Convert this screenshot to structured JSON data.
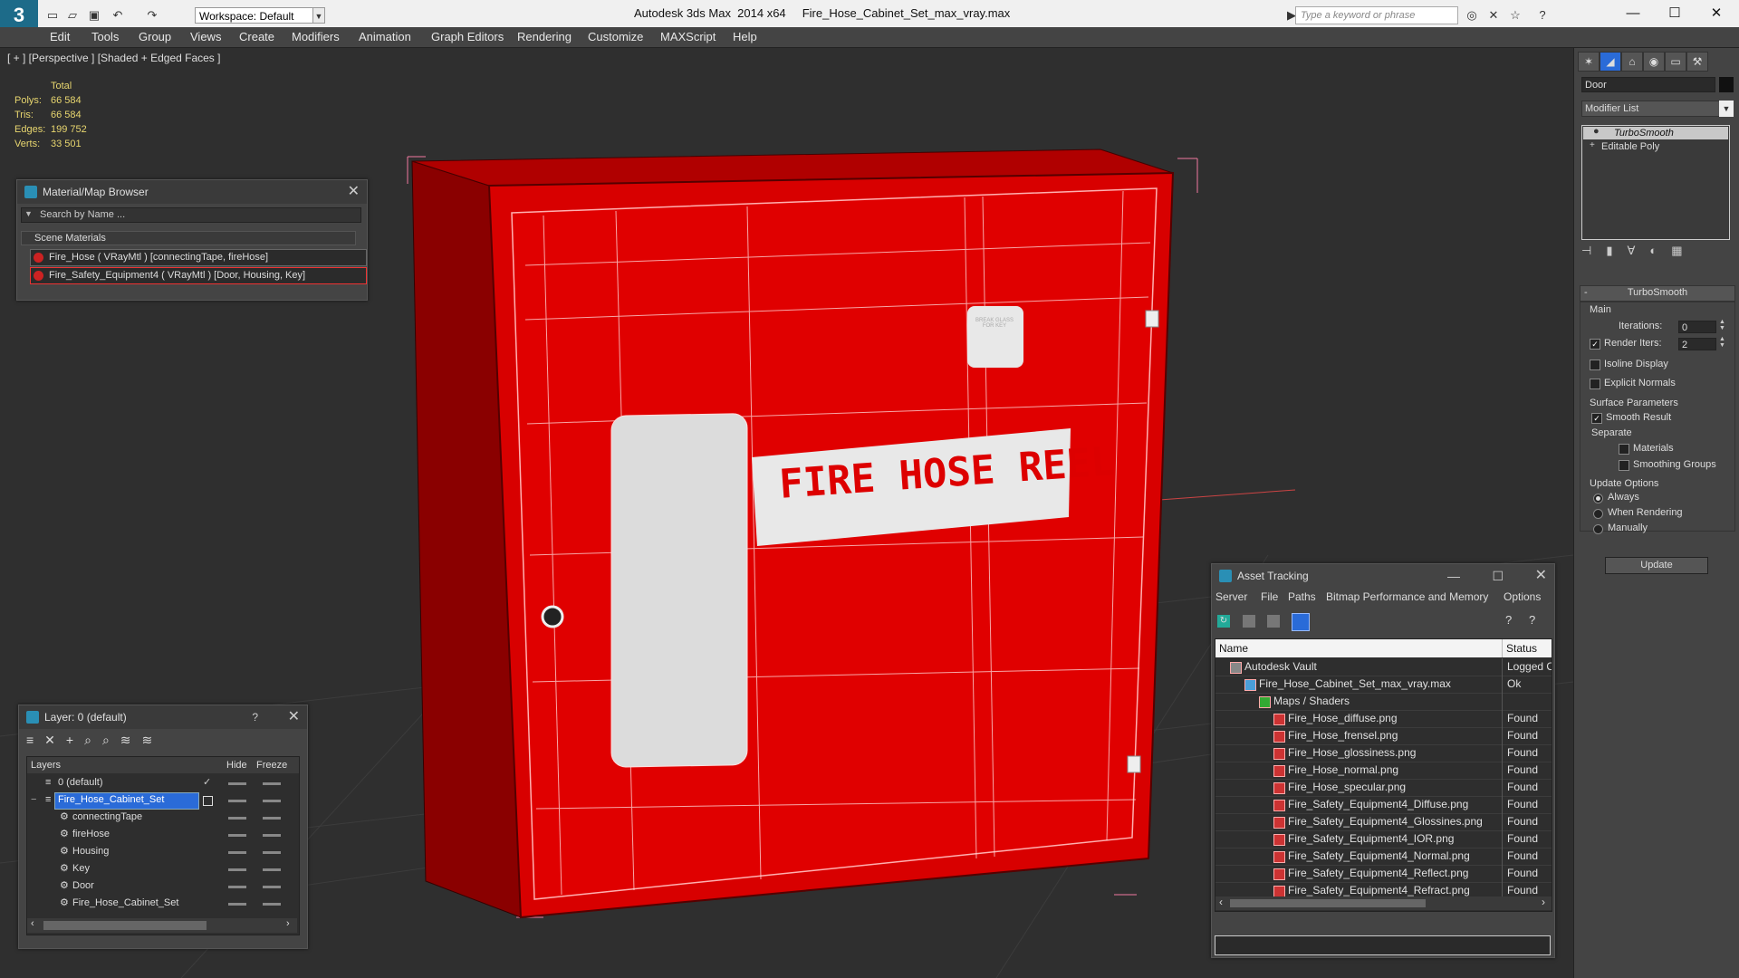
{
  "titlebar": {
    "workspace": "Workspace: Default",
    "title": "Autodesk 3ds Max  2014 x64     Fire_Hose_Cabinet_Set_max_vray.max",
    "search_placeholder": "Type a keyword or phrase"
  },
  "menu": [
    "Edit",
    "Tools",
    "Group",
    "Views",
    "Create",
    "Modifiers",
    "Animation",
    "Graph Editors",
    "Rendering",
    "Customize",
    "MAXScript",
    "Help"
  ],
  "viewport": {
    "label": "[ + ] [Perspective ] [Shaded + Edged Faces ]",
    "stats": {
      "header": "Total",
      "rows": [
        {
          "label": "Polys:",
          "value": "66 584"
        },
        {
          "label": "Tris:",
          "value": "66 584"
        },
        {
          "label": "Edges:",
          "value": "199 752"
        },
        {
          "label": "Verts:",
          "value": "33 501"
        }
      ]
    },
    "sign_text": "FIRE HOSE REEL",
    "small_sign_text": "BREAK GLASS FOR KEY"
  },
  "material_browser": {
    "title": "Material/Map Browser",
    "search_placeholder": "Search by Name ...",
    "section": "Scene Materials",
    "items": [
      "Fire_Hose  ( VRayMtl )  [connectingTape, fireHose]",
      "Fire_Safety_Equipment4  ( VRayMtl )  [Door, Housing, Key]"
    ]
  },
  "layer_panel": {
    "title": "Layer: 0 (default)",
    "help": "?",
    "columns": [
      "Layers",
      "Hide",
      "Freeze"
    ],
    "rows": [
      {
        "name": "0 (default)",
        "indent": 1
      },
      {
        "name": "Fire_Hose_Cabinet_Set",
        "indent": 1,
        "selected": true
      },
      {
        "name": "connectingTape",
        "indent": 2
      },
      {
        "name": "fireHose",
        "indent": 2
      },
      {
        "name": "Housing",
        "indent": 2
      },
      {
        "name": "Key",
        "indent": 2
      },
      {
        "name": "Door",
        "indent": 2
      },
      {
        "name": "Fire_Hose_Cabinet_Set",
        "indent": 2
      }
    ]
  },
  "asset_tracking": {
    "title": "Asset Tracking",
    "menu": [
      "Server",
      "File",
      "Paths",
      "Bitmap Performance and Memory",
      "Options"
    ],
    "columns": [
      "Name",
      "Status"
    ],
    "rows": [
      {
        "name": "Autodesk Vault",
        "status": "Logged O",
        "indent": 1
      },
      {
        "name": "Fire_Hose_Cabinet_Set_max_vray.max",
        "status": "Ok",
        "indent": 2
      },
      {
        "name": "Maps / Shaders",
        "status": "",
        "indent": 3
      },
      {
        "name": "Fire_Hose_diffuse.png",
        "status": "Found",
        "indent": 4
      },
      {
        "name": "Fire_Hose_frensel.png",
        "status": "Found",
        "indent": 4
      },
      {
        "name": "Fire_Hose_glossiness.png",
        "status": "Found",
        "indent": 4
      },
      {
        "name": "Fire_Hose_normal.png",
        "status": "Found",
        "indent": 4
      },
      {
        "name": "Fire_Hose_specular.png",
        "status": "Found",
        "indent": 4
      },
      {
        "name": "Fire_Safety_Equipment4_Diffuse.png",
        "status": "Found",
        "indent": 4
      },
      {
        "name": "Fire_Safety_Equipment4_Glossines.png",
        "status": "Found",
        "indent": 4
      },
      {
        "name": "Fire_Safety_Equipment4_IOR.png",
        "status": "Found",
        "indent": 4
      },
      {
        "name": "Fire_Safety_Equipment4_Normal.png",
        "status": "Found",
        "indent": 4
      },
      {
        "name": "Fire_Safety_Equipment4_Reflect.png",
        "status": "Found",
        "indent": 4
      },
      {
        "name": "Fire_Safety_Equipment4_Refract.png",
        "status": "Found",
        "indent": 4
      }
    ]
  },
  "command_panel": {
    "object_name": "Door",
    "modifier_list": "Modifier List",
    "stack": [
      "TurboSmooth",
      "Editable Poly"
    ],
    "rollout_title": "TurboSmooth",
    "main_label": "Main",
    "iterations_label": "Iterations:",
    "iterations_value": "0",
    "render_iters_label": "Render Iters:",
    "render_iters_value": "2",
    "isoline": "Isoline Display",
    "explicit": "Explicit Normals",
    "surface_params": "Surface Parameters",
    "smooth_result": "Smooth Result",
    "separate": "Separate",
    "materials": "Materials",
    "smoothing_groups": "Smoothing Groups",
    "update_options": "Update Options",
    "always": "Always",
    "when_rendering": "When Rendering",
    "manually": "Manually",
    "update_btn": "Update"
  }
}
